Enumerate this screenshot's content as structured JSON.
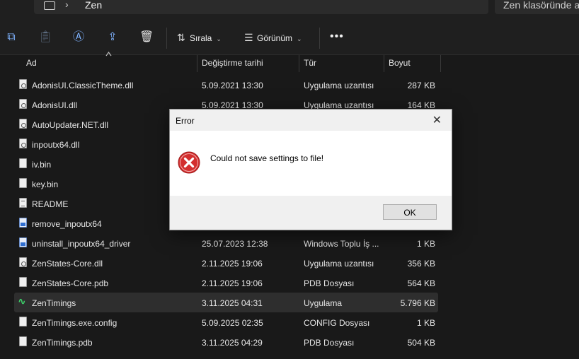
{
  "address": {
    "current_folder": "Zen",
    "pc_icon": "monitor-icon"
  },
  "search": {
    "placeholder": "Zen klasöründe ara"
  },
  "toolbar": {
    "icons": [
      "copy-icon",
      "paste-icon",
      "rename-icon",
      "share-icon",
      "delete-icon"
    ],
    "sort_label": "Sırala",
    "view_label": "Görünüm",
    "more_label": "•••"
  },
  "columns": {
    "name": "Ad",
    "modified": "Değiştirme tarihi",
    "type": "Tür",
    "size": "Boyut"
  },
  "files": [
    {
      "name": "AdonisUI.ClassicTheme.dll",
      "date": "5.09.2021 13:30",
      "type": "Uygulama uzantısı",
      "size": "287 KB",
      "icon": "dll-file-icon"
    },
    {
      "name": "AdonisUI.dll",
      "date": "5.09.2021 13:30",
      "type": "Uygulama uzantısı",
      "size": "164 KB",
      "icon": "dll-file-icon"
    },
    {
      "name": "AutoUpdater.NET.dll",
      "date": "",
      "type": "",
      "size": "",
      "icon": "dll-file-icon"
    },
    {
      "name": "inpoutx64.dll",
      "date": "",
      "type": "",
      "size": "",
      "icon": "dll-file-icon"
    },
    {
      "name": "iv.bin",
      "date": "",
      "type": "",
      "size": "",
      "icon": "file-icon"
    },
    {
      "name": "key.bin",
      "date": "",
      "type": "",
      "size": "",
      "icon": "file-icon"
    },
    {
      "name": "README",
      "date": "",
      "type": "",
      "size": "",
      "icon": "text-file-icon"
    },
    {
      "name": "remove_inpoutx64",
      "date": "",
      "type": "",
      "size": "",
      "icon": "batch-file-icon"
    },
    {
      "name": "uninstall_inpoutx64_driver",
      "date": "25.07.2023 12:38",
      "type": "Windows Toplu İş ...",
      "size": "1 KB",
      "icon": "batch-file-icon"
    },
    {
      "name": "ZenStates-Core.dll",
      "date": "2.11.2025 19:06",
      "type": "Uygulama uzantısı",
      "size": "356 KB",
      "icon": "dll-file-icon"
    },
    {
      "name": "ZenStates-Core.pdb",
      "date": "2.11.2025 19:06",
      "type": "PDB Dosyası",
      "size": "564 KB",
      "icon": "file-icon"
    },
    {
      "name": "ZenTimings",
      "date": "3.11.2025 04:31",
      "type": "Uygulama",
      "size": "5.796 KB",
      "icon": "zentimings-app-icon",
      "selected": true
    },
    {
      "name": "ZenTimings.exe.config",
      "date": "5.09.2025 02:35",
      "type": "CONFIG Dosyası",
      "size": "1 KB",
      "icon": "file-icon"
    },
    {
      "name": "ZenTimings.pdb",
      "date": "3.11.2025 04:29",
      "type": "PDB Dosyası",
      "size": "504 KB",
      "icon": "file-icon"
    }
  ],
  "dialog": {
    "title": "Error",
    "message": "Could not save settings to file!",
    "ok_label": "OK",
    "close_glyph": "✕",
    "icon": "error-icon",
    "error_color": "#d32f2f"
  },
  "colors": {
    "background": "#191919",
    "accent": "#7fb3ff",
    "selected_row": "#2e2e2e"
  }
}
